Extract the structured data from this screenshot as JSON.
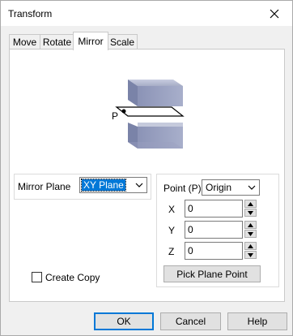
{
  "window": {
    "title": "Transform"
  },
  "tabs": [
    {
      "label": "Move"
    },
    {
      "label": "Rotate"
    },
    {
      "label": "Mirror"
    },
    {
      "label": "Scale"
    }
  ],
  "active_tab": "Mirror",
  "illustration": {
    "point_label": "P"
  },
  "mirror_plane": {
    "label": "Mirror Plane",
    "value": "XY Plane"
  },
  "point": {
    "label": "Point (P)",
    "value": "Origin",
    "fields": [
      {
        "label": "X",
        "value": "0"
      },
      {
        "label": "Y",
        "value": "0"
      },
      {
        "label": "Z",
        "value": "0"
      }
    ],
    "pick_button": "Pick Plane Point"
  },
  "create_copy": {
    "label": "Create Copy",
    "checked": false
  },
  "buttons": {
    "ok": "OK",
    "cancel": "Cancel",
    "help": "Help"
  }
}
